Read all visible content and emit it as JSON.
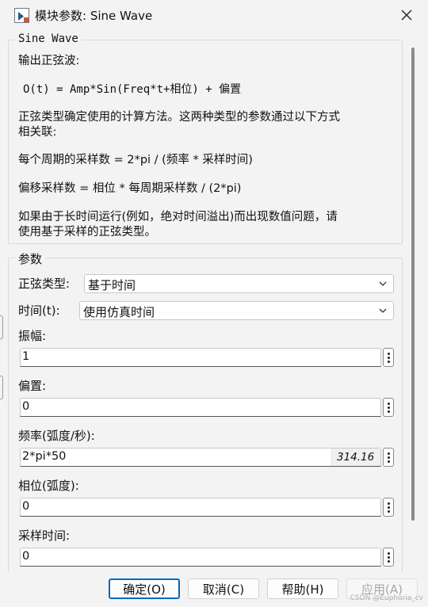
{
  "window": {
    "title": "模块参数: Sine Wave",
    "icon": "simulink-block-icon",
    "close_icon": "close-icon"
  },
  "description": {
    "legend": "Sine Wave",
    "lines": [
      "输出正弦波:",
      "O(t) = Amp*Sin(Freq*t+相位) + 偏置",
      "正弦类型确定使用的计算方法。这两种类型的参数通过以下方式",
      "相关联:",
      "每个周期的采样数 = 2*pi / (频率 * 采样时间)",
      "偏移采样数 = 相位 * 每周期采样数 / (2*pi)",
      "如果由于长时间运行(例如，绝对时间溢出)而出现数值问题，请",
      "使用基于采样的正弦类型。"
    ]
  },
  "parameters": {
    "legend": "参数",
    "sine_type": {
      "label": "正弦类型:",
      "value": "基于时间"
    },
    "time": {
      "label": "时间(t):",
      "value": "使用仿真时间"
    },
    "amplitude": {
      "label": "振幅:",
      "value": "1"
    },
    "bias": {
      "label": "偏置:",
      "value": "0"
    },
    "frequency": {
      "label": "频率(弧度/秒):",
      "value": "2*pi*50",
      "evaluated": "314.16"
    },
    "phase": {
      "label": "相位(弧度):",
      "value": "0"
    },
    "sample_time": {
      "label": "采样时间:",
      "value": "0"
    }
  },
  "buttons": {
    "ok": "确定(O)",
    "cancel": "取消(C)",
    "help": "帮助(H)",
    "apply": "应用(A)"
  },
  "watermark": "CSDN @Euphoria_cv",
  "colors": {
    "accent": "#0067c0",
    "background": "#f3f3f3"
  }
}
